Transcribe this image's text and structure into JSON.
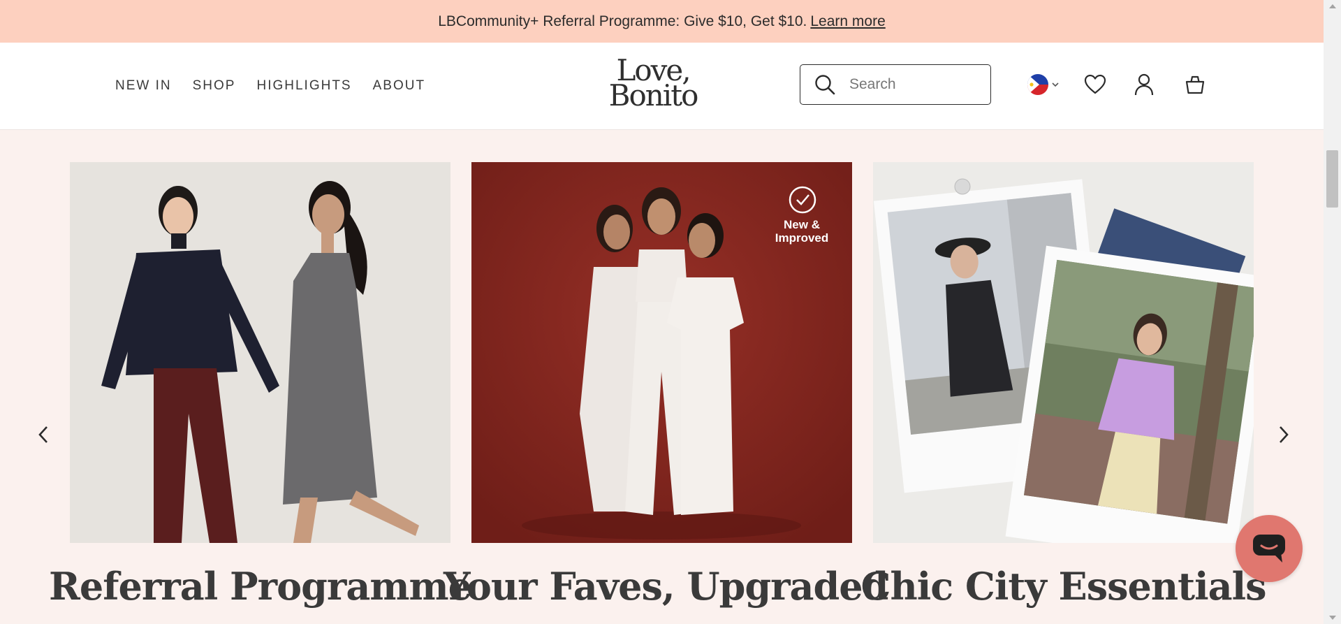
{
  "promo": {
    "text": "LBCommunity+ Referral Programme: Give $10, Get $10.",
    "link": "Learn more"
  },
  "nav": {
    "items": [
      {
        "label": "NEW IN"
      },
      {
        "label": "SHOP"
      },
      {
        "label": "HIGHLIGHTS"
      },
      {
        "label": "ABOUT"
      }
    ]
  },
  "logo": {
    "line1": "Love,",
    "line2": "Bonito"
  },
  "search": {
    "placeholder": "Search"
  },
  "header_icons": [
    "philippines-flag-icon",
    "chevron-down-icon",
    "heart-icon",
    "user-icon",
    "bag-icon"
  ],
  "cards": [
    {
      "title": "Referral Programme"
    },
    {
      "title": "Your Faves, Upgraded",
      "badge_line1": "New &",
      "badge_line2": "Improved"
    },
    {
      "title": "Chic City Essentials"
    }
  ],
  "colors": {
    "promo_bg": "#fdd0bf",
    "page_bg": "#fbf1ee",
    "card2_bg": "#8a2a22",
    "chat_button": "#e0776f"
  }
}
